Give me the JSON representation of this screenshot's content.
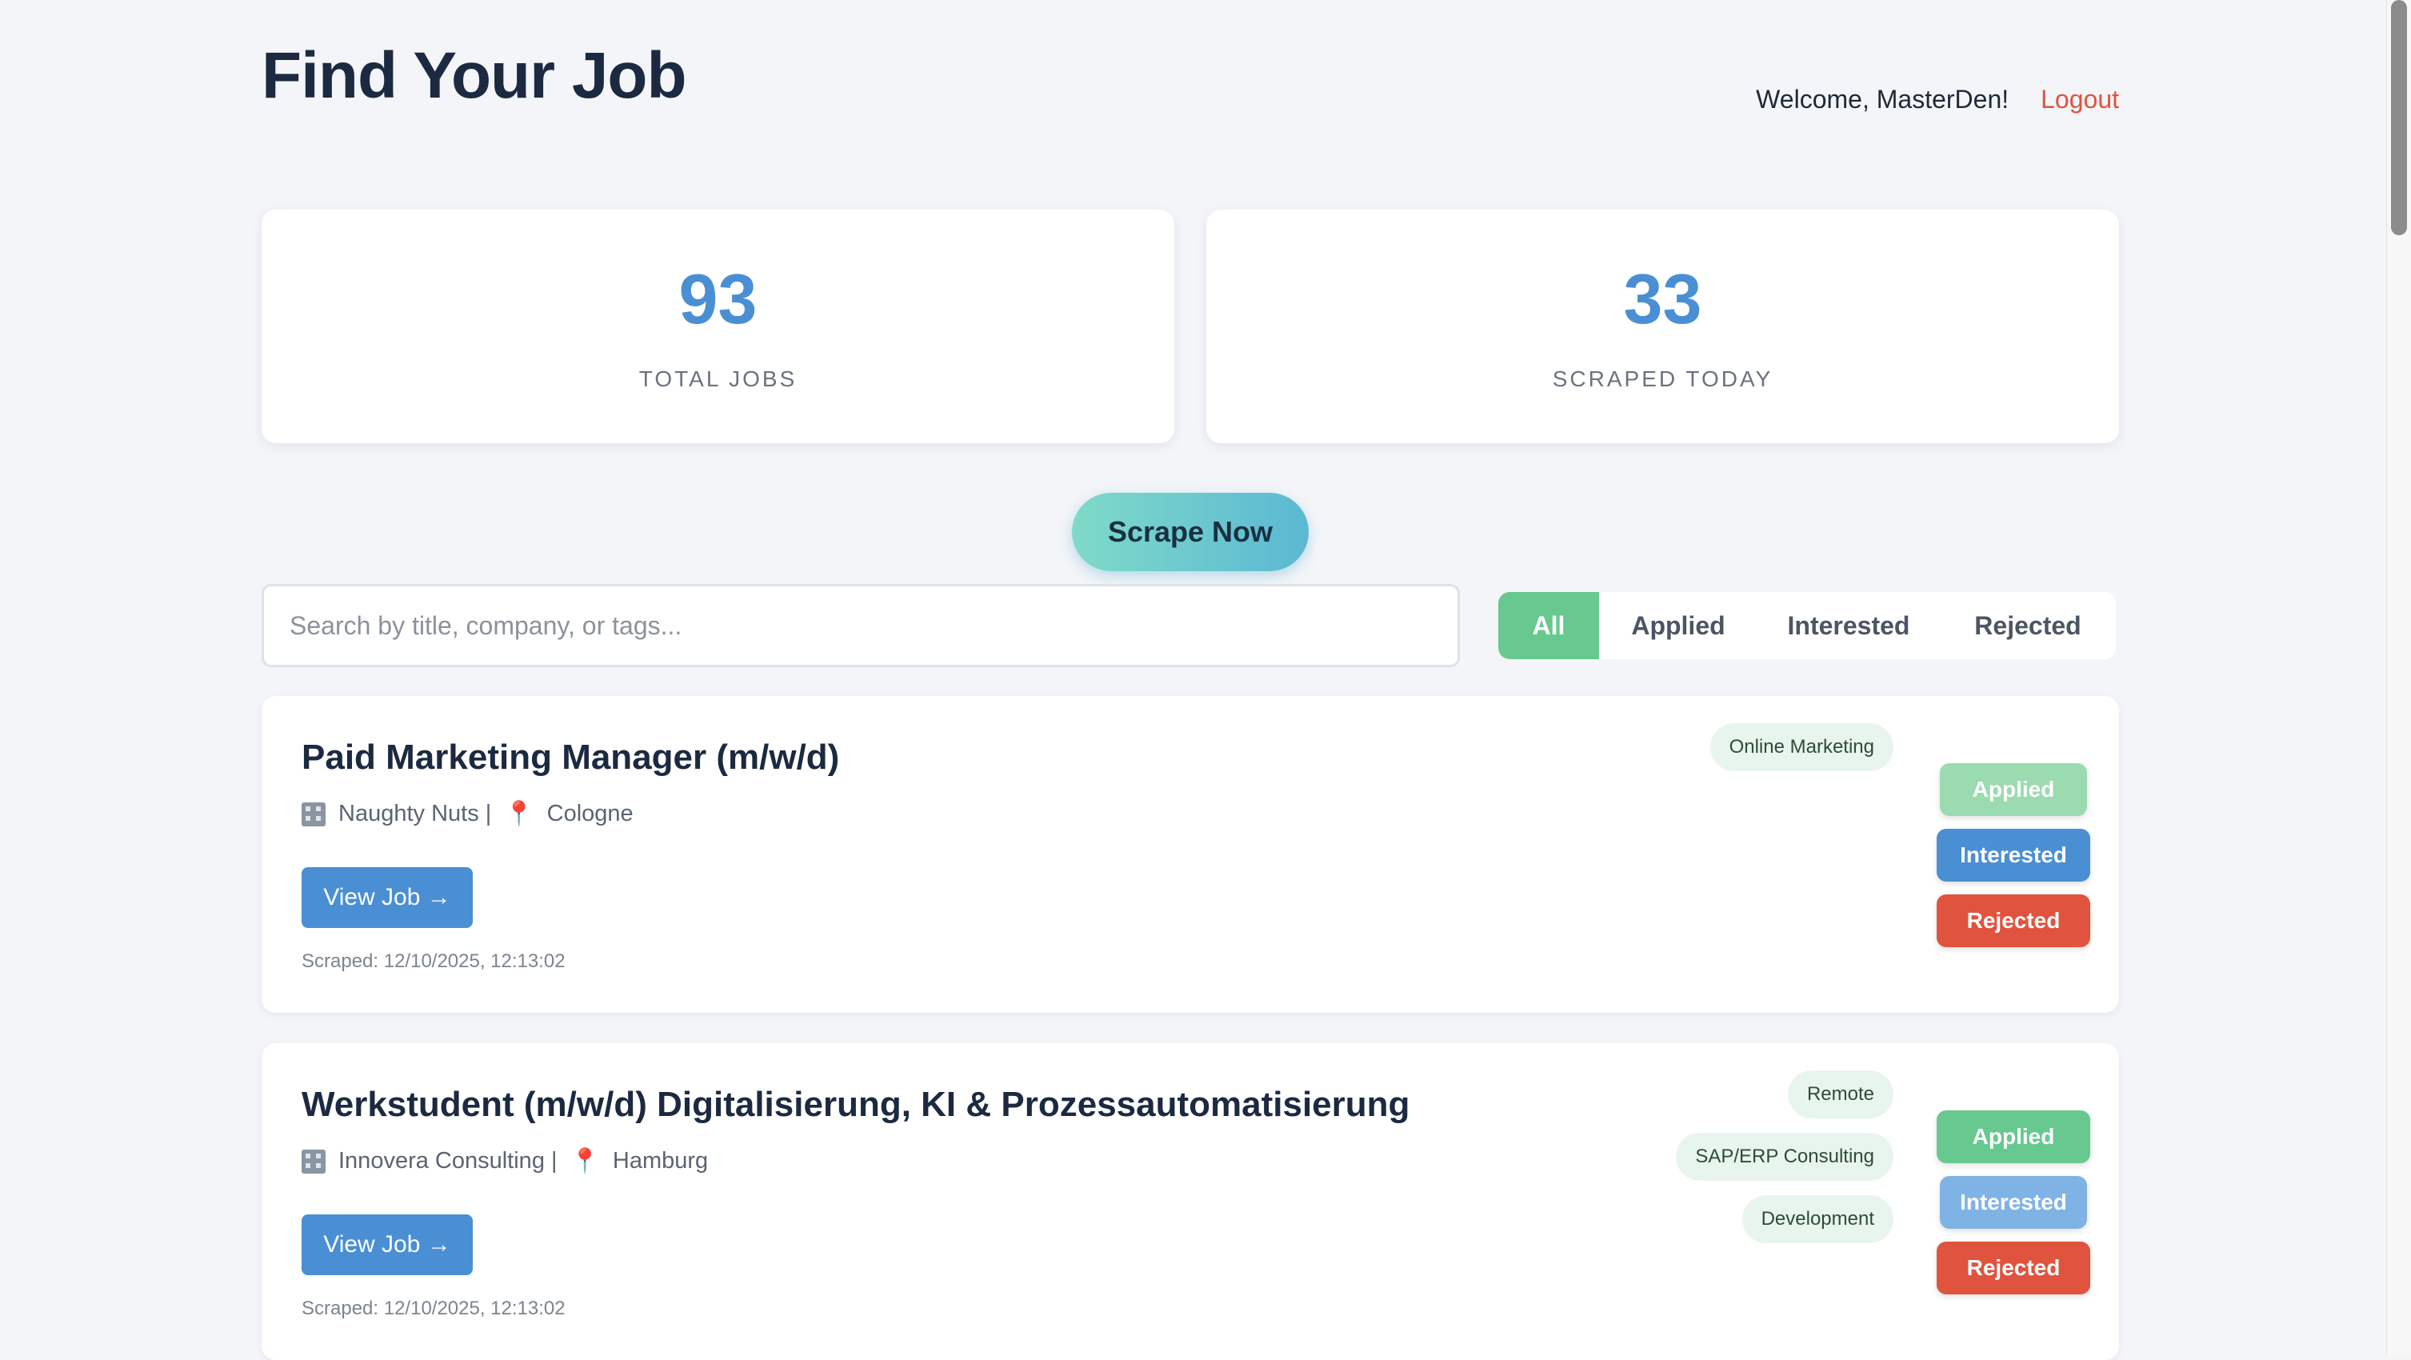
{
  "header": {
    "title": "Find Your Job",
    "welcome": "Welcome, MasterDen!",
    "logout": "Logout"
  },
  "stats": [
    {
      "value": "93",
      "label": "TOTAL JOBS"
    },
    {
      "value": "33",
      "label": "SCRAPED TODAY"
    }
  ],
  "scrape_button": "Scrape Now",
  "search": {
    "placeholder": "Search by title, company, or tags...",
    "value": ""
  },
  "filters": {
    "tabs": [
      "All",
      "Applied",
      "Interested",
      "Rejected"
    ],
    "active": "All"
  },
  "jobs": [
    {
      "title": "Paid Marketing Manager (m/w/d)",
      "company": "Naughty Nuts |",
      "location": "Cologne",
      "view_label": "View Job →",
      "scraped": "Scraped: 12/10/2025, 12:13:02",
      "tags": [
        "Online Marketing"
      ],
      "applied_label": "Applied",
      "interested_label": "Interested",
      "rejected_label": "Rejected"
    },
    {
      "title": "Werkstudent (m/w/d) Digitalisierung, KI & Prozessautomatisierung",
      "company": "Innovera Consulting |",
      "location": "Hamburg",
      "view_label": "View Job →",
      "scraped": "Scraped: 12/10/2025, 12:13:02",
      "tags": [
        "Remote",
        "SAP/ERP Consulting",
        "Development"
      ],
      "applied_label": "Applied",
      "interested_label": "Interested",
      "rejected_label": "Rejected"
    }
  ],
  "icons": {
    "company": "building-icon",
    "location": "map-pin-icon"
  },
  "colors": {
    "accent_blue": "#4a8fd4",
    "applied_green": "#67c98f",
    "rejected_red": "#e0533f",
    "logout_red": "#e0533f"
  }
}
